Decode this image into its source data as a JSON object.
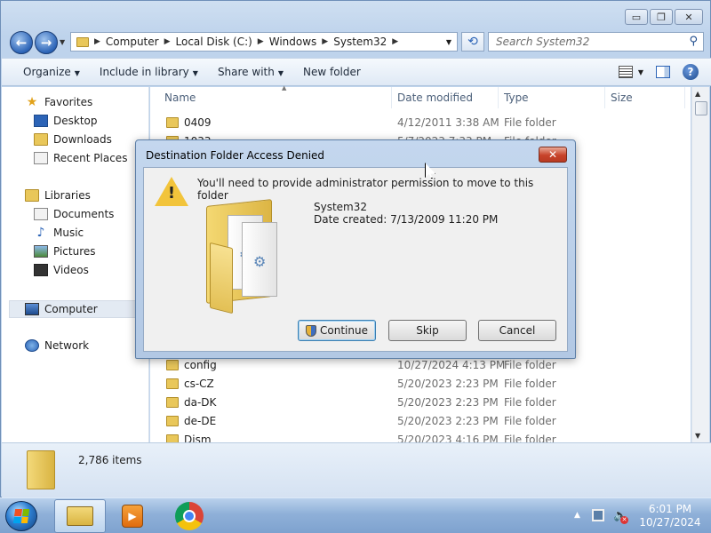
{
  "window": {
    "caption_buttons": {
      "minimize": "▭",
      "maximize": "❐",
      "close": "✕"
    }
  },
  "address_bar": {
    "breadcrumb": [
      "Computer",
      "Local Disk (C:)",
      "Windows",
      "System32"
    ],
    "search_placeholder": "Search System32"
  },
  "toolbar": {
    "organize": "Organize",
    "include_in_library": "Include in library",
    "share_with": "Share with",
    "new_folder": "New folder"
  },
  "nav_pane": {
    "favorites": {
      "label": "Favorites",
      "items": [
        "Desktop",
        "Downloads",
        "Recent Places"
      ]
    },
    "libraries": {
      "label": "Libraries",
      "items": [
        "Documents",
        "Music",
        "Pictures",
        "Videos"
      ]
    },
    "computer": "Computer",
    "network": "Network"
  },
  "file_list": {
    "columns": [
      "Name",
      "Date modified",
      "Type",
      "Size"
    ],
    "rows": [
      {
        "name": "0409",
        "date": "4/12/2011 3:38 AM",
        "type": "File folder"
      },
      {
        "name": "1033",
        "date": "5/7/2023 7:33 PM",
        "type": "File folder"
      },
      {
        "name": "config",
        "date": "10/27/2024 4:13 PM",
        "type": "File folder"
      },
      {
        "name": "cs-CZ",
        "date": "5/20/2023 2:23 PM",
        "type": "File folder"
      },
      {
        "name": "da-DK",
        "date": "5/20/2023 2:23 PM",
        "type": "File folder"
      },
      {
        "name": "de-DE",
        "date": "5/20/2023 2:23 PM",
        "type": "File folder"
      },
      {
        "name": "Dism",
        "date": "5/20/2023 4:16 PM",
        "type": "File folder"
      }
    ]
  },
  "details_pane": {
    "item_count": "2,786 items"
  },
  "dialog": {
    "title": "Destination Folder Access Denied",
    "close": "✕",
    "message": "You'll need to provide administrator permission to move to this folder",
    "folder_name": "System32",
    "date_created": "Date created: 7/13/2009 11:20 PM",
    "buttons": {
      "continue": "Continue",
      "skip": "Skip",
      "cancel": "Cancel"
    }
  },
  "taskbar": {
    "clock_time": "6:01 PM",
    "clock_date": "10/27/2024"
  },
  "colors": {
    "accent": "#2c64b7",
    "folder": "#e9c75a",
    "dialog_close": "#c8432a"
  }
}
